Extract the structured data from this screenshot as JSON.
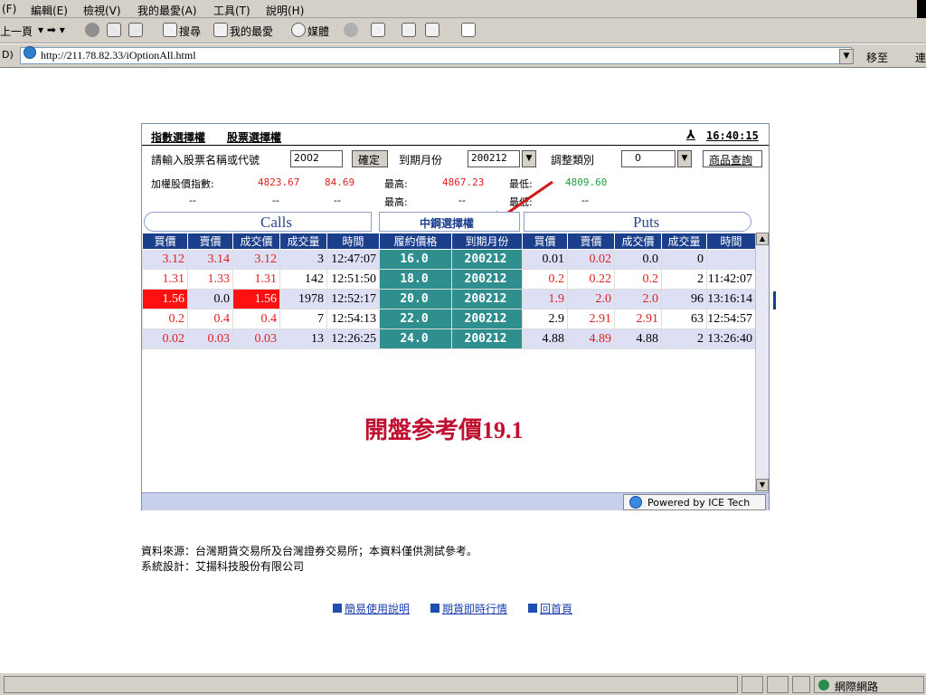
{
  "browser": {
    "menu": [
      "(F)",
      "編輯(E)",
      "檢視(V)",
      "我的最愛(A)",
      "工具(T)",
      "說明(H)"
    ],
    "toolbar": {
      "back": "上一頁",
      "search": "搜尋",
      "favorites": "我的最愛",
      "media": "媒體"
    },
    "address_prefix": "D)",
    "address": "http://211.78.82.33/iOptionAll.html",
    "go_label": "移至",
    "links_label": "連",
    "status_zone": "網際網路"
  },
  "panel": {
    "tabs": [
      "指數選擇權",
      "股票選擇權"
    ],
    "time": "16:40:15",
    "person_icon": "person-icon",
    "search_label": "請輸入股票名稱或代號",
    "search_value": "2002",
    "confirm": "確定",
    "month_label": "到期月份",
    "month_value": "200212",
    "adjust_label": "調整類別",
    "adjust_value": "0",
    "product_query": "商品查詢",
    "index": {
      "label": "加權股價指數:",
      "value": "4823.67",
      "change": "84.69",
      "high_label": "最高:",
      "high": "4867.23",
      "low_label": "最低:",
      "low": "4809.60",
      "row2_a": "--",
      "row2_b": "--",
      "row2_c": "--",
      "high2_label": "最高:",
      "high2": "--",
      "low2_label": "最低:",
      "low2": "--"
    },
    "banner": {
      "calls": "Calls",
      "center": "中鋼選擇權",
      "puts": "Puts"
    },
    "columns": [
      "買價",
      "賣價",
      "成交價",
      "成交量",
      "時間",
      "履約價格",
      "到期月份",
      "買價",
      "賣價",
      "成交價",
      "成交量",
      "時間"
    ],
    "rows": [
      {
        "c_bid": "3.12",
        "c_ask": "3.14",
        "c_last": "3.12",
        "c_vol": "3",
        "c_time": "12:47:07",
        "strike": "16.0",
        "month": "200212",
        "p_bid": "0.01",
        "p_ask": "0.02",
        "p_last": "0.0",
        "p_vol": "0",
        "p_time": ""
      },
      {
        "c_bid": "1.31",
        "c_ask": "1.33",
        "c_last": "1.31",
        "c_vol": "142",
        "c_time": "12:51:50",
        "strike": "18.0",
        "month": "200212",
        "p_bid": "0.2",
        "p_ask": "0.22",
        "p_last": "0.2",
        "p_vol": "2",
        "p_time": "11:42:07"
      },
      {
        "c_bid": "1.56",
        "c_ask": "0.0",
        "c_last": "1.56",
        "c_vol": "1978",
        "c_time": "12:52:17",
        "strike": "20.0",
        "month": "200212",
        "p_bid": "1.9",
        "p_ask": "2.0",
        "p_last": "2.0",
        "p_vol": "96",
        "p_time": "13:16:14"
      },
      {
        "c_bid": "0.2",
        "c_ask": "0.4",
        "c_last": "0.4",
        "c_vol": "7",
        "c_time": "12:54:13",
        "strike": "22.0",
        "month": "200212",
        "p_bid": "2.9",
        "p_ask": "2.91",
        "p_last": "2.91",
        "p_vol": "63",
        "p_time": "12:54:57"
      },
      {
        "c_bid": "0.02",
        "c_ask": "0.03",
        "c_last": "0.03",
        "c_vol": "13",
        "c_time": "12:26:25",
        "strike": "24.0",
        "month": "200212",
        "p_bid": "4.88",
        "p_ask": "4.89",
        "p_last": "4.88",
        "p_vol": "2",
        "p_time": "13:26:40"
      }
    ],
    "message": "開盤参考價19.1",
    "powered": "Powered by ICE Tech"
  },
  "source_line": "資料來源：台灣期貨交易所及台灣證券交易所；本資料僅供測試參考。",
  "design_line": "系統設計：艾揚科技股份有限公司",
  "links": [
    "簡易使用說明",
    "期貨即時行情",
    "回首頁"
  ],
  "colors": {
    "header": "#1c3f8c",
    "teal": "#2f8f8f",
    "red": "#e02020",
    "stripe": "#dde0f4"
  }
}
